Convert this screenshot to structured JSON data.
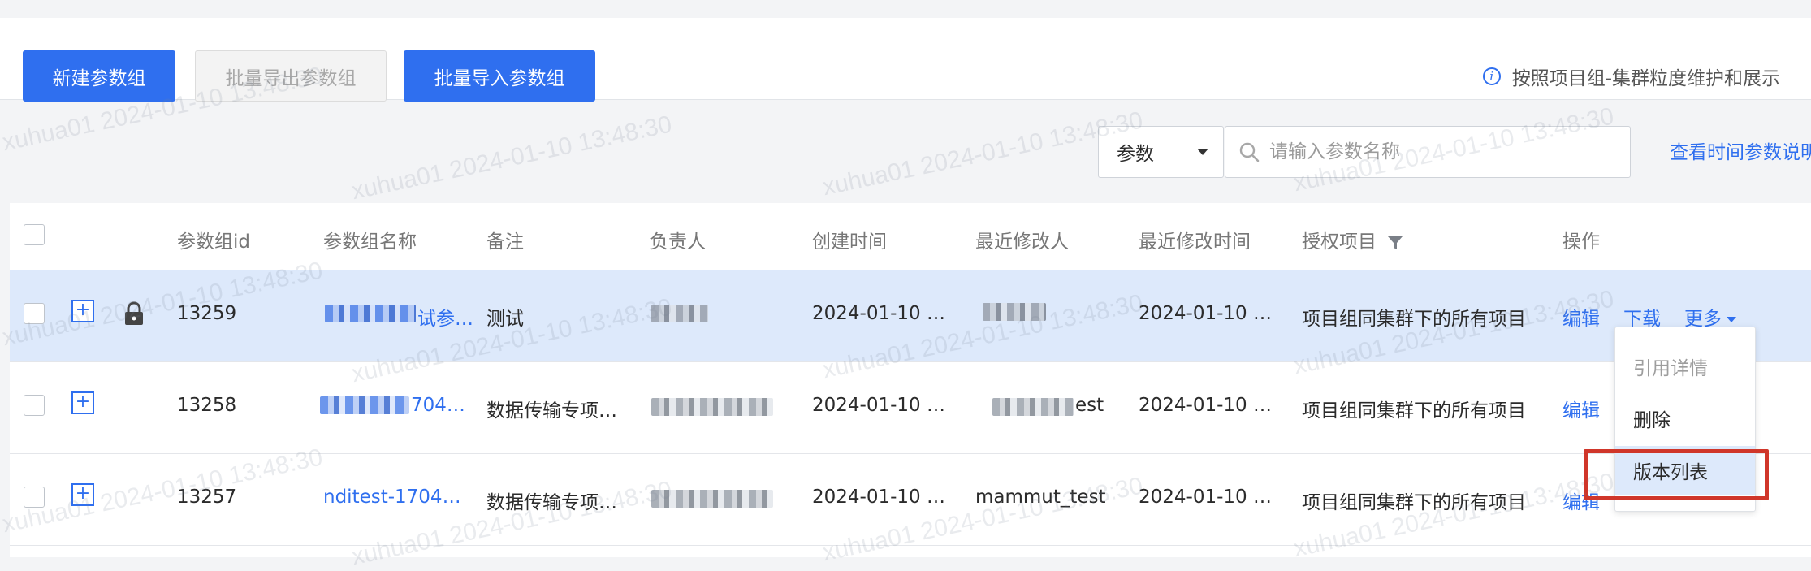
{
  "toolbar": {
    "new_group": "新建参数组",
    "batch_export": "批量导出参数组",
    "batch_import": "批量导入参数组",
    "tip": "按照项目组-集群粒度维护和展示"
  },
  "filter": {
    "type_value": "参数",
    "search_placeholder": "请输入参数名称",
    "help_link": "查看时间参数说明"
  },
  "table": {
    "columns": [
      "参数组id",
      "参数组名称",
      "备注",
      "负责人",
      "创建时间",
      "最近修改人",
      "最近修改时间",
      "授权项目",
      "操作"
    ],
    "rows": [
      {
        "id": "13259",
        "name": "试参…",
        "remark": "测试",
        "owner": "",
        "created": "2024-01-10 …",
        "modifier": "",
        "modified": "2024-01-10 …",
        "project": "项目组同集群下的所有项目",
        "locked": true
      },
      {
        "id": "13258",
        "name": "704…",
        "remark": "数据传输专项…",
        "owner": "",
        "created": "2024-01-10 …",
        "modifier": "est",
        "modified": "2024-01-10 …",
        "project": "项目组同集群下的所有项目",
        "locked": false
      },
      {
        "id": "13257",
        "name": "nditest-1704…",
        "remark": "数据传输专项…",
        "owner": "",
        "created": "2024-01-10 …",
        "modifier": "mammut_test",
        "modified": "2024-01-10 …",
        "project": "项目组同集群下的所有项目",
        "locked": false
      }
    ],
    "actions": {
      "edit": "编辑",
      "download": "下载",
      "more": "更多"
    }
  },
  "menu": {
    "items": [
      "引用详情",
      "删除",
      "版本列表"
    ]
  },
  "watermark": "xuhua01 2024-01-10 13:48:30",
  "colors": {
    "primary": "#2f6fef",
    "selected_row": "#dde9fb",
    "highlight": "#d0362a"
  }
}
